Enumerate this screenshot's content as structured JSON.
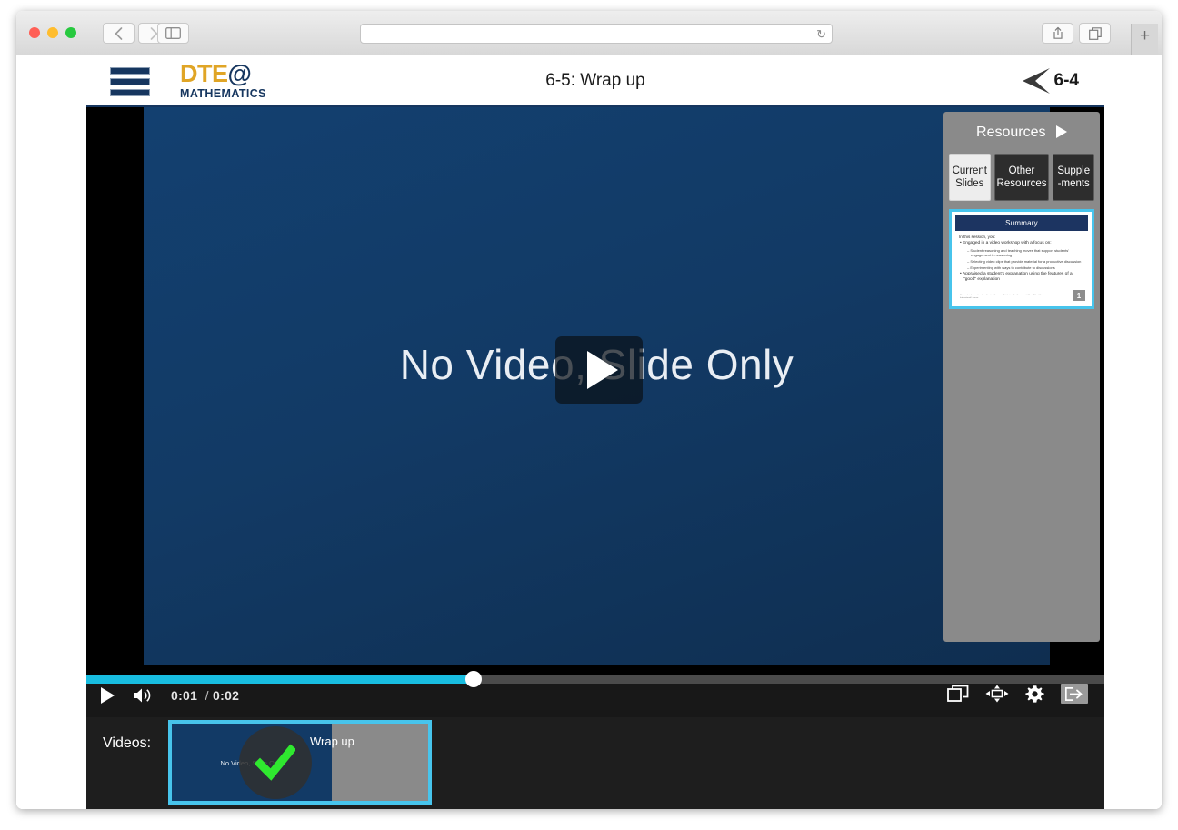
{
  "browser": {
    "traffic_lights": [
      "close",
      "minimize",
      "maximize"
    ],
    "back_icon": "chevron-left-icon",
    "forward_icon": "chevron-right-icon",
    "sidebar_icon": "sidebar-toggle-icon",
    "address_value": "",
    "address_placeholder": "",
    "reload_icon": "reload-icon",
    "share_icon": "share-icon",
    "tabs_icon": "show-tabs-icon",
    "newtab_label": "+"
  },
  "app": {
    "menu_icon": "hamburger-menu-icon",
    "logo": {
      "main": "DTE",
      "at": "@",
      "sub": "MATHEMATICS"
    },
    "title": "6-5: Wrap up",
    "back_nav": {
      "icon": "chevron-left-icon",
      "label": "6-4"
    }
  },
  "player": {
    "slide_text": "No Video, Slide Only",
    "play_overlay_icon": "play-icon",
    "controls": {
      "play_icon": "play-icon",
      "volume_icon": "volume-icon",
      "current_time": "0:01",
      "separator": "/",
      "duration": "0:02",
      "progress_percent": 38,
      "pip_icon": "picture-in-picture-icon",
      "resize_icon": "move-resize-icon",
      "settings_icon": "gear-icon",
      "exit_icon": "exit-arrow-icon"
    }
  },
  "resources": {
    "title": "Resources",
    "expand_icon": "play-triangle-icon",
    "tabs": [
      {
        "label": "Current Slides",
        "line1": "Current",
        "line2": "Slides",
        "active": true
      },
      {
        "label": "Other Resources",
        "line1": "Other",
        "line2": "Resources",
        "active": false
      },
      {
        "label": "Supplements",
        "line1": "Supple",
        "line2": "-ments",
        "active": false
      }
    ],
    "slide": {
      "heading": "Summary",
      "lead": "In this session, you:",
      "bullet1": "Engaged in a video workshop with a focus on:",
      "sub1": "Student reasoning and teaching moves that support students' engagement in reasoning",
      "sub2": "Selecting video clips that provide material for a productive discussion",
      "sub3": "Experimenting with ways to contribute to discussions",
      "bullet2": "Appraised a student's explanation using the features of a \"good\" explanation",
      "footnote": "This work is licensed under a Creative Commons Attribution-NonCommercial-ShareAlike 4.0 International License.",
      "page_number": "1"
    }
  },
  "videos": {
    "label": "Videos:",
    "items": [
      {
        "title": "Wrap up",
        "preview_text": "No Video, Slide Only",
        "completed": true,
        "check_icon": "check-icon",
        "selected": true
      }
    ]
  },
  "colors": {
    "brand_navy": "#16365f",
    "brand_gold": "#e0a526",
    "accent_cyan": "#47c4ec",
    "progress_cyan": "#18bde0",
    "check_green": "#2fe82f",
    "panel_gray": "#8a8a8a"
  }
}
